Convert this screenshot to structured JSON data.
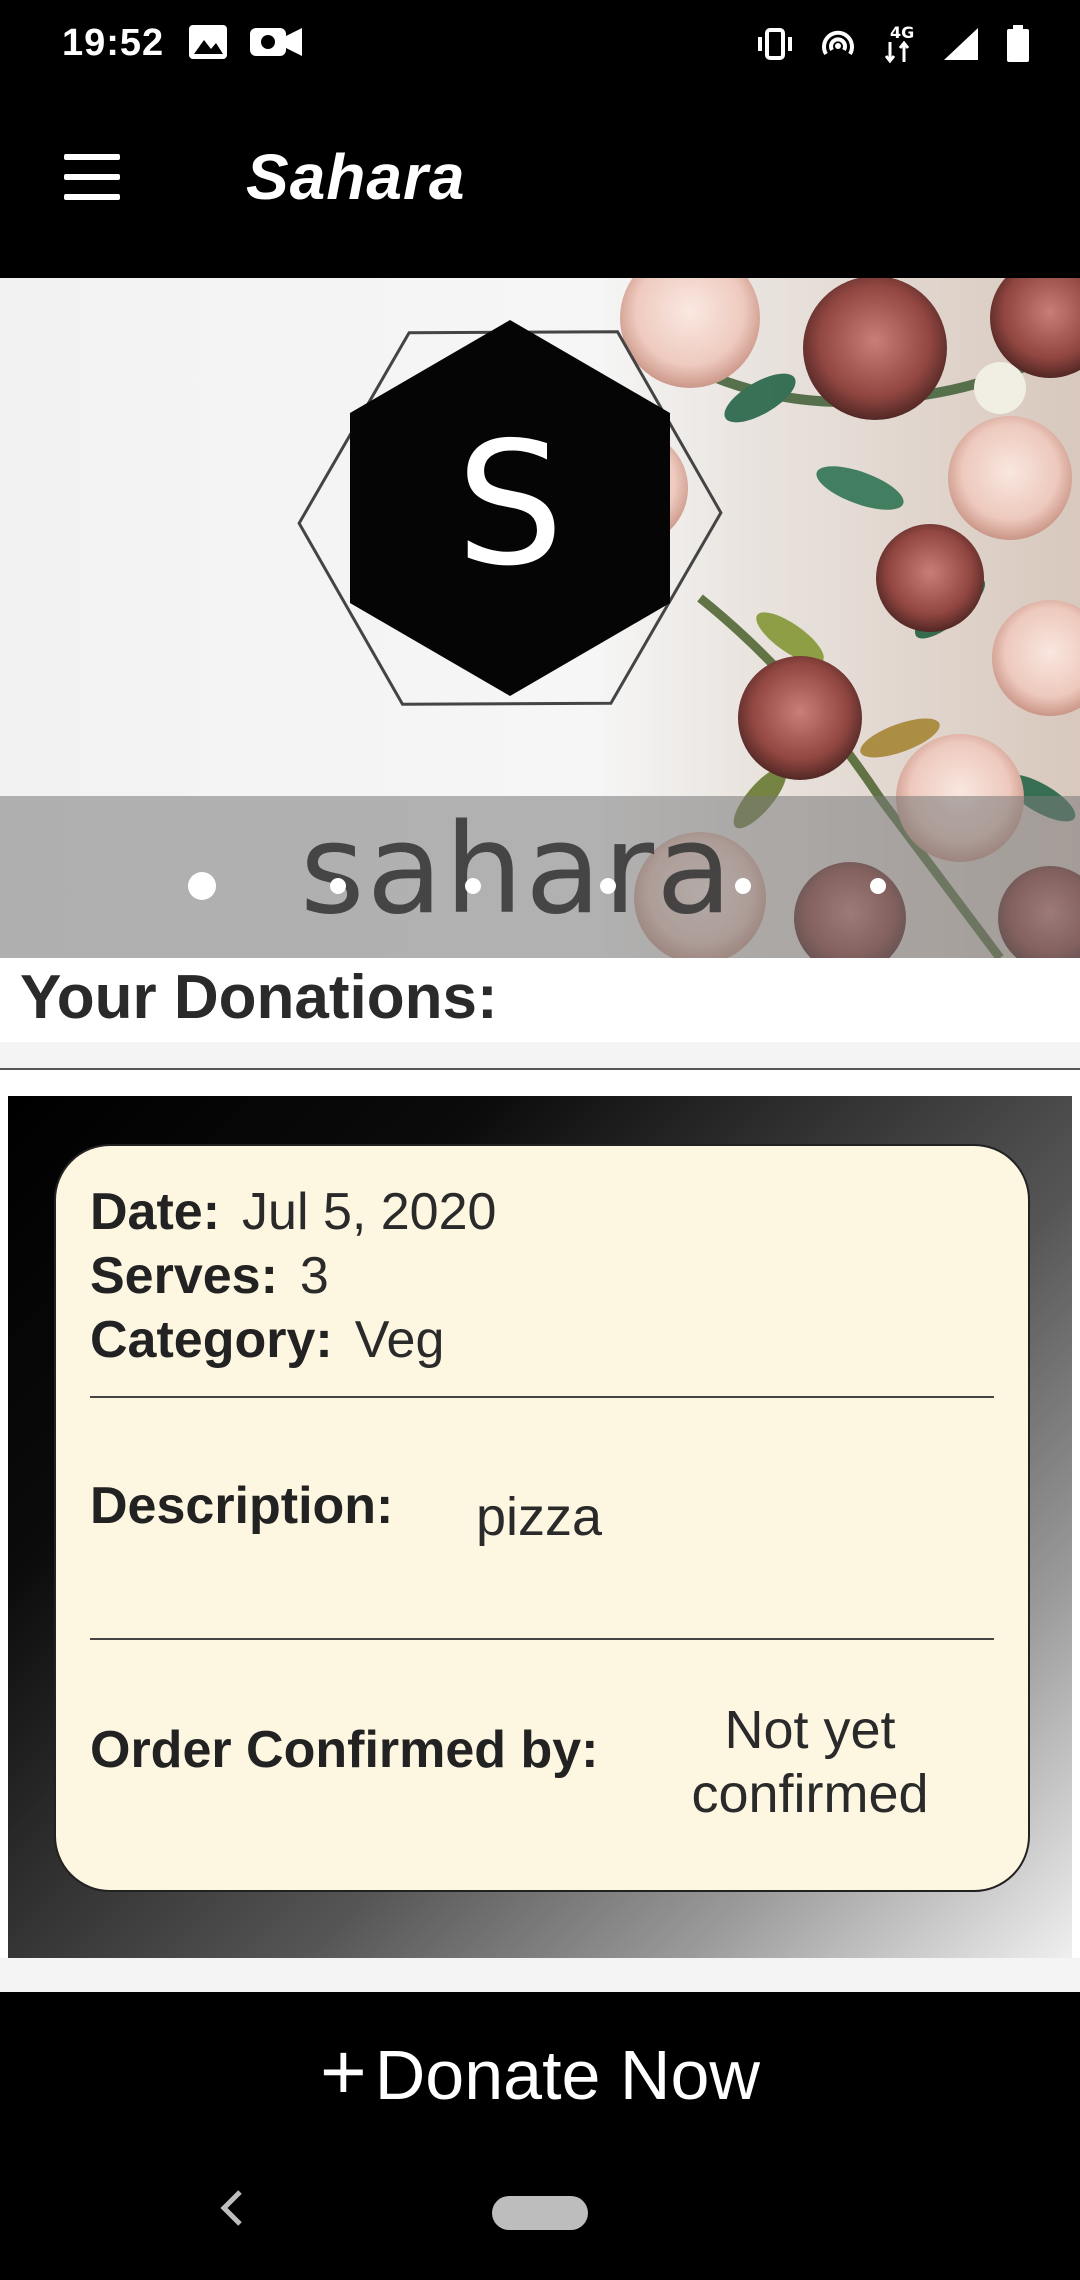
{
  "status_bar": {
    "time": "19:52",
    "left_icons": [
      "image-icon",
      "video-camera-icon"
    ],
    "right_icons": [
      "vibrate-icon",
      "hotspot-icon",
      "4g-data-icon",
      "signal-icon",
      "battery-icon"
    ],
    "network_label": "4G"
  },
  "app_bar": {
    "title": "Sahara",
    "menu_icon": "hamburger-menu-icon"
  },
  "banner": {
    "logo_letter": "S",
    "wordmark": "sahara",
    "page_indicator": {
      "count": 6,
      "active_index": 0
    }
  },
  "main": {
    "heading": "Your Donations:"
  },
  "donation_card": {
    "date_label": "Date:",
    "date_value": "Jul 5, 2020",
    "serves_label": "Serves:",
    "serves_value": "3",
    "category_label": "Category:",
    "category_value": "Veg",
    "description_label": "Description:",
    "description_value": "pizza",
    "order_label": "Order Confirmed by:",
    "order_value_line1": "Not yet",
    "order_value_line2": "confirmed"
  },
  "donate": {
    "plus": "+",
    "label": "Donate Now"
  },
  "colors": {
    "card_background": "#fdf6e1",
    "bars": "#000000"
  }
}
